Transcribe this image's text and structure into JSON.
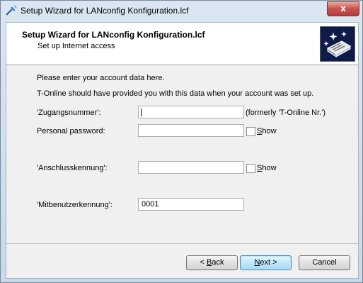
{
  "window": {
    "title": "Setup Wizard for LANconfig Konfiguration.lcf",
    "close_glyph": "x"
  },
  "header": {
    "title": "Setup Wizard for LANconfig Konfiguration.lcf",
    "subtitle": "Set up Internet access",
    "logo_icon": "router-wizard-icon"
  },
  "body": {
    "intro_line1": "Please enter your account data here.",
    "intro_line2": "T-Online should have provided you with this data when your account was set up."
  },
  "form": {
    "zugangsnummer": {
      "label": "'Zugangsnummer':",
      "value": "",
      "hint": "(formerly 'T-Online Nr.')"
    },
    "password": {
      "label": "Personal password:",
      "value": "",
      "show_label_first": "S",
      "show_label_rest": "how",
      "show_checked": false
    },
    "anschlusskennung": {
      "label": "'Anschlusskennung':",
      "value": "",
      "show_label_first": "S",
      "show_label_rest": "how",
      "show_checked": false
    },
    "mitbenutzerkennung": {
      "label": "'Mitbenutzerkennung':",
      "value": "0001"
    }
  },
  "buttons": {
    "back_prefix": "< ",
    "back_mnemonic": "B",
    "back_rest": "ack",
    "next_mnemonic": "N",
    "next_rest": "ext >",
    "cancel": "Cancel"
  }
}
